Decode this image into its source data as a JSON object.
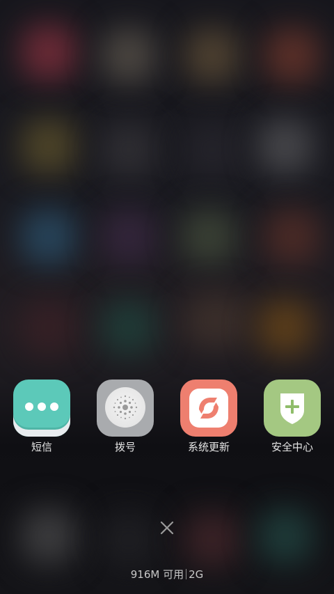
{
  "recents": {
    "apps": [
      {
        "label": "短信",
        "icon": "sms-dots-icon",
        "color": "#5cc9b9"
      },
      {
        "label": "拨号",
        "icon": "dialer-keypad-icon",
        "color": "#a9abae"
      },
      {
        "label": "系统更新",
        "icon": "system-update-icon",
        "color": "#ee7f6f"
      },
      {
        "label": "安全中心",
        "icon": "security-shield-icon",
        "color": "#a4c882"
      }
    ],
    "close_icon": "close-x-icon",
    "memory": {
      "free": "916M 可用",
      "total": "2G"
    }
  }
}
